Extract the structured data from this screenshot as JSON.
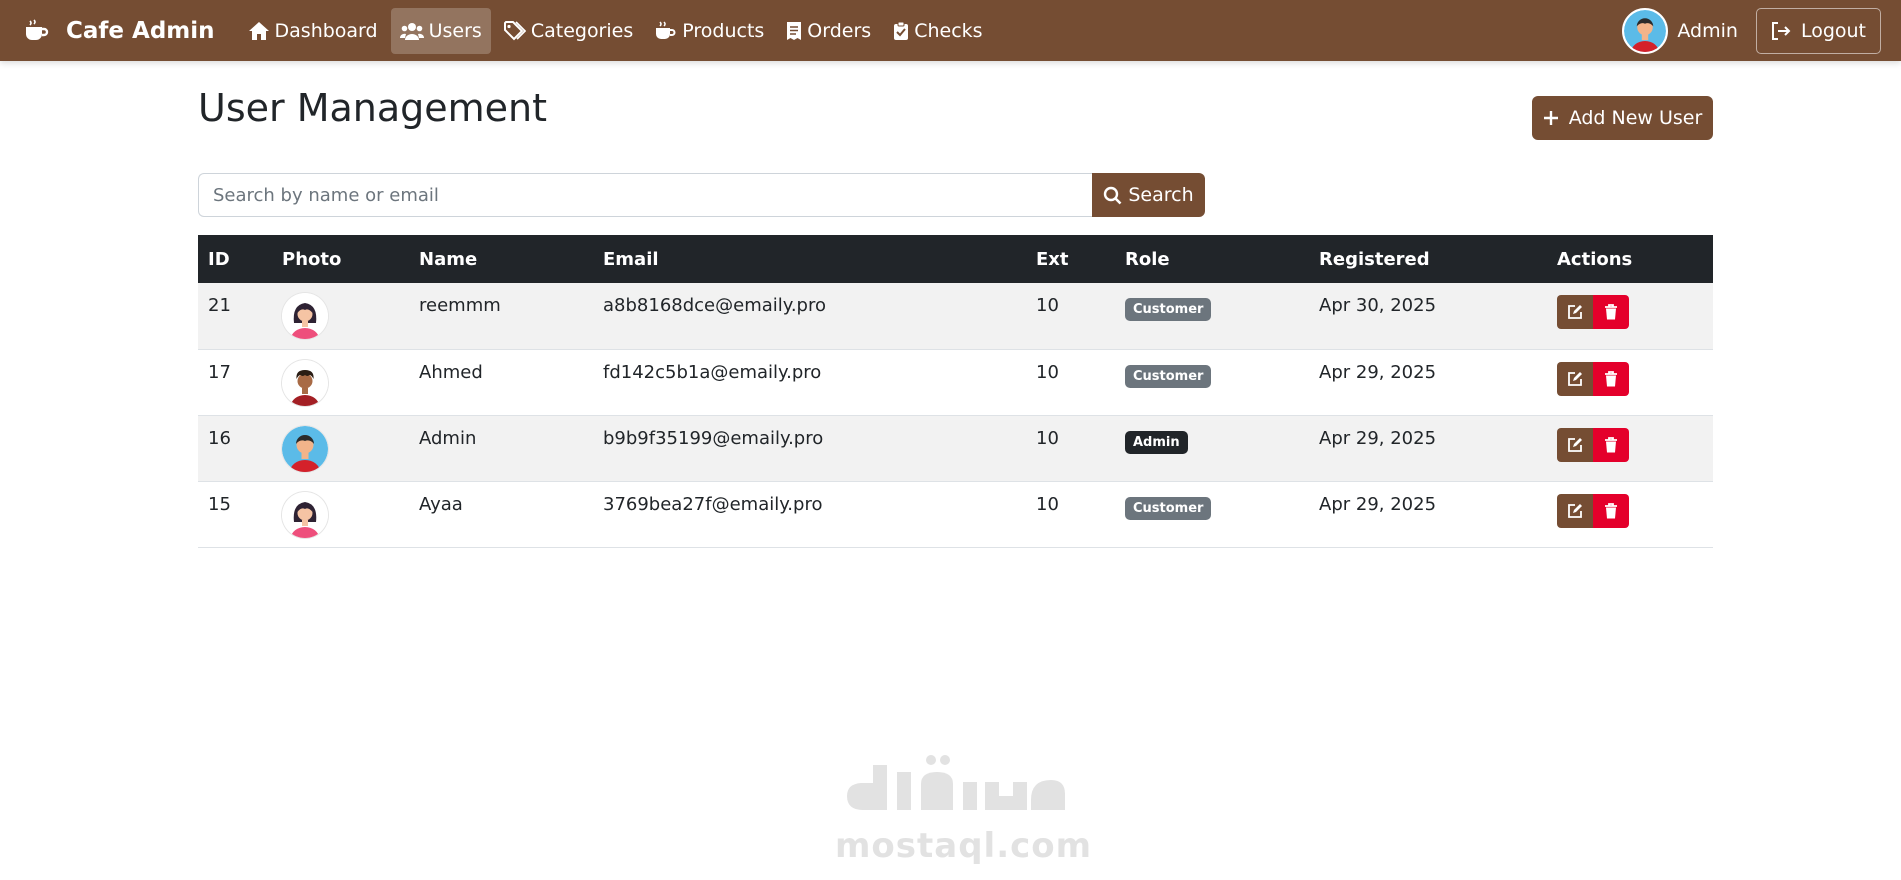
{
  "nav": {
    "brand": "Cafe Admin",
    "links": [
      {
        "label": "Dashboard",
        "icon": "home-icon"
      },
      {
        "label": "Users",
        "icon": "users-icon",
        "active": true
      },
      {
        "label": "Categories",
        "icon": "tags-icon"
      },
      {
        "label": "Products",
        "icon": "coffee-icon"
      },
      {
        "label": "Orders",
        "icon": "receipt-icon"
      },
      {
        "label": "Checks",
        "icon": "clipboard-check-icon"
      }
    ],
    "user": "Admin",
    "logout": "Logout"
  },
  "page": {
    "title": "User Management",
    "add_button": "Add New User"
  },
  "search": {
    "placeholder": "Search by name or email",
    "value": "",
    "button": "Search"
  },
  "table": {
    "headers": [
      "ID",
      "Photo",
      "Name",
      "Email",
      "Ext",
      "Role",
      "Registered",
      "Actions"
    ],
    "rows": [
      {
        "id": "21",
        "photo": "female-avatar",
        "name": "reemmm",
        "email": "a8b8168dce@emaily.pro",
        "ext": "10",
        "role": "Customer",
        "registered": "Apr 30, 2025"
      },
      {
        "id": "17",
        "photo": "male-avatar-curly",
        "name": "Ahmed",
        "email": "fd142c5b1a@emaily.pro",
        "ext": "10",
        "role": "Customer",
        "registered": "Apr 29, 2025"
      },
      {
        "id": "16",
        "photo": "male-avatar-blue",
        "name": "Admin",
        "email": "b9b9f35199@emaily.pro",
        "ext": "10",
        "role": "Admin",
        "registered": "Apr 29, 2025"
      },
      {
        "id": "15",
        "photo": "female-avatar",
        "name": "Ayaa",
        "email": "3769bea27f@emaily.pro",
        "ext": "10",
        "role": "Customer",
        "registered": "Apr 29, 2025"
      }
    ]
  },
  "watermark": {
    "logo_text": "مستقل",
    "domain": "mostaql.com"
  },
  "colors": {
    "brand_brown": "#754d33",
    "danger_red": "#e4002b",
    "table_header": "#212529",
    "badge_customer": "#6c757d",
    "badge_admin": "#212529"
  }
}
